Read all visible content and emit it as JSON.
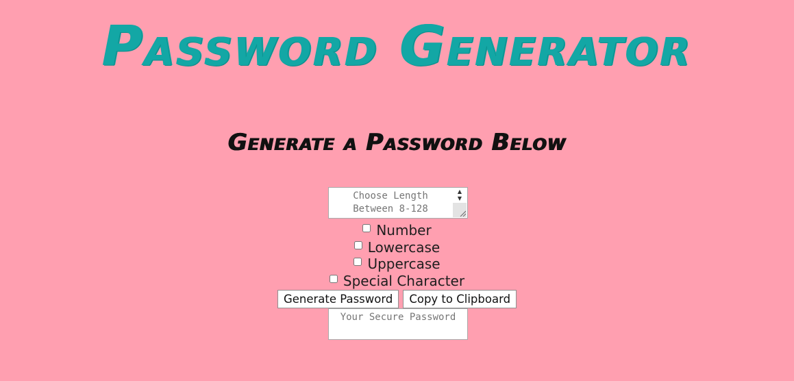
{
  "header": {
    "title": "Password Generator",
    "subtitle": "Generate a Password Below"
  },
  "length_input": {
    "placeholder": "Choose Length\nBetween 8-128",
    "value": ""
  },
  "options": [
    {
      "label": "Number",
      "checked": false
    },
    {
      "label": "Lowercase",
      "checked": false
    },
    {
      "label": "Uppercase",
      "checked": false
    },
    {
      "label": "Special Character",
      "checked": false
    }
  ],
  "buttons": {
    "generate_label": "Generate Password",
    "copy_label": "Copy to Clipboard"
  },
  "output": {
    "placeholder": "Your Secure Password",
    "value": ""
  },
  "colors": {
    "background": "#ff9fb0",
    "title": "#13a7a5",
    "subtitle": "#111111"
  }
}
